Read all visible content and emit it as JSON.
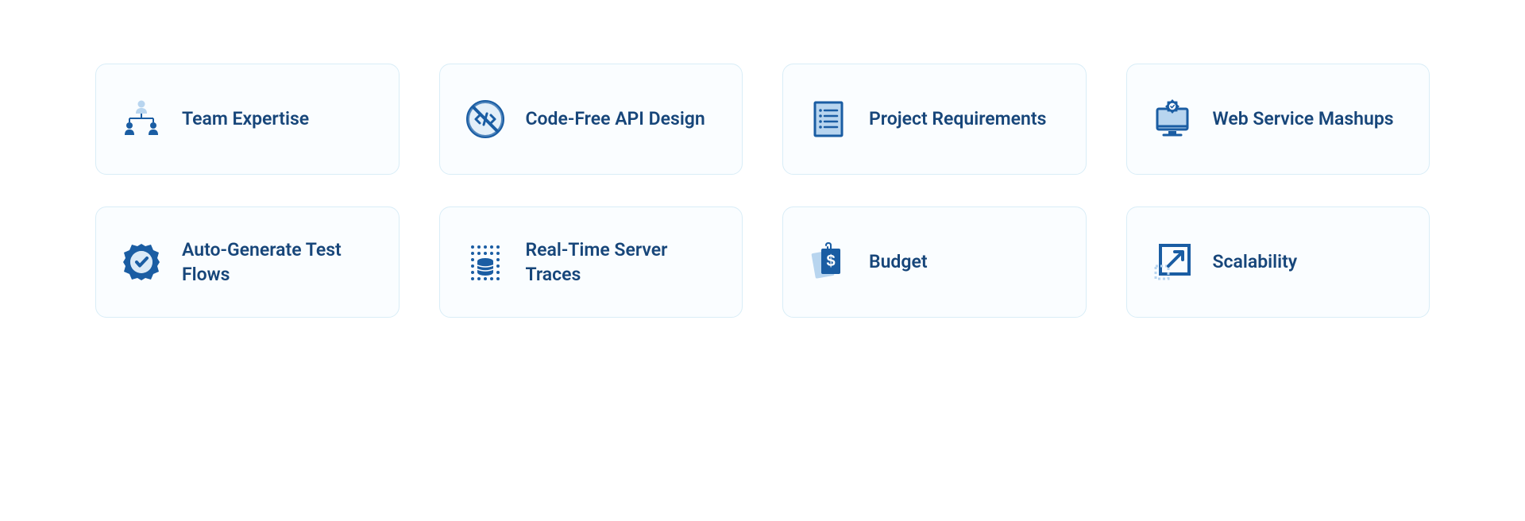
{
  "cards": [
    {
      "label": "Team Expertise"
    },
    {
      "label": "Code-Free API Design"
    },
    {
      "label": "Project Requirements"
    },
    {
      "label": "Web Service Mashups"
    },
    {
      "label": "Auto-Generate Test Flows"
    },
    {
      "label": "Real-Time Server Traces"
    },
    {
      "label": "Budget"
    },
    {
      "label": "Scalability"
    }
  ],
  "colors": {
    "primary": "#1a5da3",
    "light": "#b8d5ef",
    "cardBorder": "#d9edf7",
    "cardBg": "#fafdff",
    "text": "#17467a"
  }
}
